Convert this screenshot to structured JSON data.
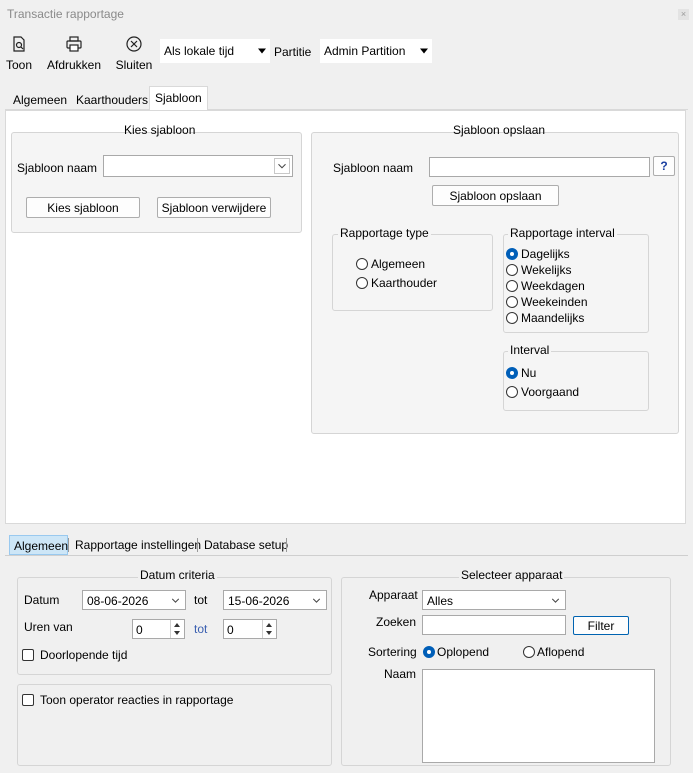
{
  "window": {
    "title": "Transactie rapportage",
    "close_glyph": "×"
  },
  "toolbar": {
    "buttons": [
      {
        "label": "Toon",
        "icon": "document-search-icon"
      },
      {
        "label": "Afdrukken",
        "icon": "printer-icon"
      },
      {
        "label": "Sluiten",
        "icon": "close-circle-icon"
      }
    ],
    "time_select": "Als lokale tijd",
    "partition_label": "Partitie",
    "partition_select": "Admin Partition"
  },
  "top_tabs": [
    "Algemeen",
    "Kaarthouders",
    "Sjabloon"
  ],
  "kies": {
    "title": "Kies sjabloon",
    "name_label": "Sjabloon naam",
    "name_value": "",
    "choose_button": "Kies sjabloon",
    "delete_button": "Sjabloon verwijdere"
  },
  "opslaan": {
    "title": "Sjabloon opslaan",
    "name_label": "Sjabloon naam",
    "name_value": "",
    "help_glyph": "?",
    "save_button": "Sjabloon opslaan",
    "type_title": "Rapportage type",
    "type_options": [
      "Algemeen",
      "Kaarthouder"
    ],
    "interval_title": "Rapportage interval",
    "interval_options": [
      "Dagelijks",
      "Wekelijks",
      "Weekdagen",
      "Weekeinden",
      "Maandelijks"
    ],
    "interval2_title": "Interval",
    "interval2_options": [
      "Nu",
      "Voorgaand"
    ]
  },
  "bottom_tabs": [
    "Algemeen",
    "Rapportage instellingen",
    "Database setup"
  ],
  "datum": {
    "title": "Datum criteria",
    "date_label": "Datum",
    "from_date": "08-06-2026",
    "to_label": "tot",
    "to_date": "15-06-2026",
    "hours_label": "Uren van",
    "hours_from": "0",
    "hours_to_label": "tot",
    "hours_to": "0",
    "continuous_label": "Doorlopende tijd"
  },
  "operator_label": "Toon operator reacties in rapportage",
  "apparaat": {
    "title": "Selecteer apparaat",
    "device_label": "Apparaat",
    "device_value": "Alles",
    "search_label": "Zoeken",
    "search_value": "",
    "filter_button": "Filter",
    "sort_label": "Sortering",
    "sort_options": [
      "Oplopend",
      "Aflopend"
    ],
    "name_label": "Naam"
  }
}
